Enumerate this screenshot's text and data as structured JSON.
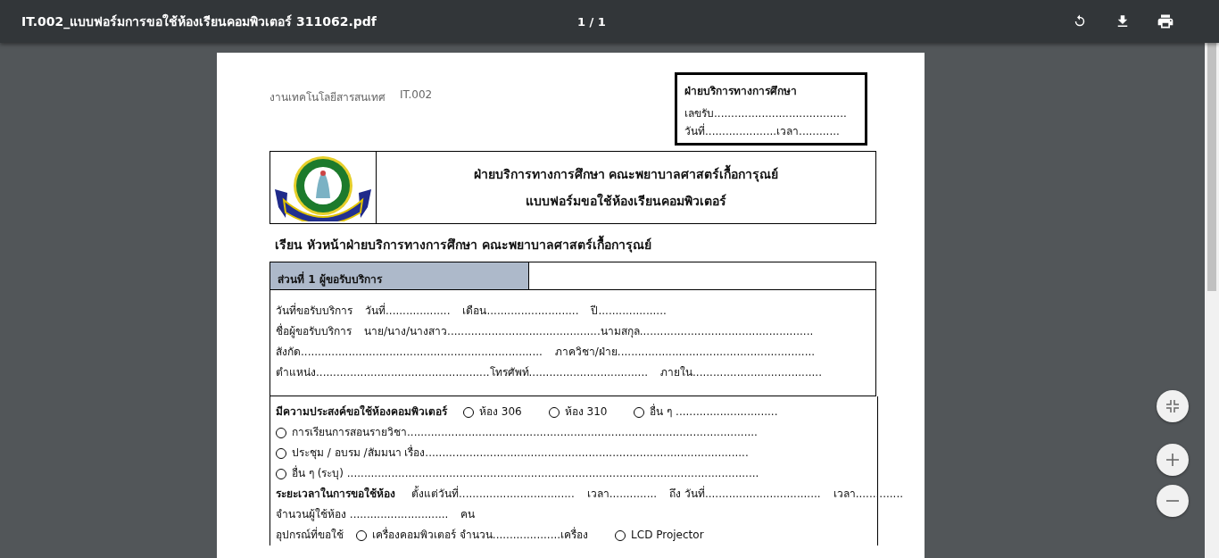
{
  "toolbar": {
    "title": "IT.002_แบบฟอร์มการขอใช้ห้องเรียนคอมพิวเตอร์ 311062.pdf",
    "page_indicator": "1 / 1"
  },
  "document": {
    "header_left": [
      "งานเทคโนโลยีสารสนเทศ",
      "IT.002"
    ],
    "stamp_box": {
      "title": "ฝ่ายบริการทางการศึกษา",
      "lines": [
        "เลขรับ.......................................",
        "วันที่.....................เวลา............"
      ]
    },
    "heading_lines": [
      "ฝ่ายบริการทางการศึกษา คณะพยาบาลศาสตร์เกื้อการุณย์",
      "แบบฟอร์มขอใช้ห้องเรียนคอมพิวเตอร์"
    ],
    "addressee": "เรียน หัวหน้าฝ่ายบริการทางการศึกษา คณะพยาบาลศาสตร์เกื้อการุณย์",
    "section_title": "ส่วนที่ 1 ผู้ขอรับบริการ",
    "section_lines": [
      {
        "parts": [
          {
            "kind": "text",
            "text": "วันที่ขอรับบริการ"
          },
          {
            "kind": "text",
            "text": "วันที่..................."
          },
          {
            "kind": "text",
            "text": "เดือน..........................."
          },
          {
            "kind": "text",
            "text": "ปี...................."
          }
        ]
      },
      {
        "parts": [
          {
            "kind": "text",
            "text": "ชื่อผู้ขอรับบริการ"
          },
          {
            "kind": "text",
            "text": "นาย/นาง/นางสาว.............................................นามสกุล..................................................."
          }
        ]
      },
      {
        "parts": [
          {
            "kind": "text",
            "text": "สังกัด......................................................................."
          },
          {
            "kind": "text",
            "text": "ภาควิชา/ฝ่าย.........................................................."
          }
        ]
      },
      {
        "parts": [
          {
            "kind": "text",
            "text": "ตำแหน่ง...................................................โทรศัพท์..................................."
          },
          {
            "kind": "text",
            "text": "ภายใน......................................"
          }
        ]
      }
    ],
    "request_lines": [
      {
        "parts": [
          {
            "kind": "label",
            "text": "มีความประสงค์ขอใช้ห้องคอมพิวเตอร์"
          },
          {
            "kind": "radio",
            "text": "ห้อง 306",
            "checked": false
          },
          {
            "kind": "radio",
            "text": "ห้อง 310",
            "checked": false
          },
          {
            "kind": "radio",
            "text": "อื่น ๆ ..............................",
            "checked": false
          }
        ]
      },
      {
        "parts": [
          {
            "kind": "radio",
            "text": "การเรียนการสอนรายวิชา.......................................................................................................",
            "checked": false
          }
        ]
      },
      {
        "parts": [
          {
            "kind": "radio",
            "text": "ประชุม / อบรม /สัมมนา เรื่อง...............................................................................................",
            "checked": false
          }
        ]
      },
      {
        "parts": [
          {
            "kind": "radio",
            "text": "อื่น ๆ (ระบุ) .........................................................................................................................",
            "checked": false
          }
        ]
      },
      {
        "parts": [
          {
            "kind": "label",
            "text": "ระยะเวลาในการขอใช้ห้อง"
          },
          {
            "kind": "text",
            "text": "ตั้งแต่วันที่.................................."
          },
          {
            "kind": "text",
            "text": "เวลา.............."
          },
          {
            "kind": "text",
            "text": "ถึง วันที่.................................."
          },
          {
            "kind": "text",
            "text": "เวลา.............."
          }
        ]
      },
      {
        "parts": [
          {
            "kind": "text",
            "text": "จำนวนผู้ใช้ห้อง ............................."
          },
          {
            "kind": "text",
            "text": "คน"
          }
        ]
      },
      {
        "parts": [
          {
            "kind": "text",
            "text": "อุปกรณ์ที่ขอใช้"
          },
          {
            "kind": "radio",
            "text": "เครื่องคอมพิวเตอร์ จำนวน....................เครื่อง",
            "checked": false
          },
          {
            "kind": "radio",
            "text": "LCD Projector",
            "checked": false
          }
        ]
      }
    ]
  }
}
